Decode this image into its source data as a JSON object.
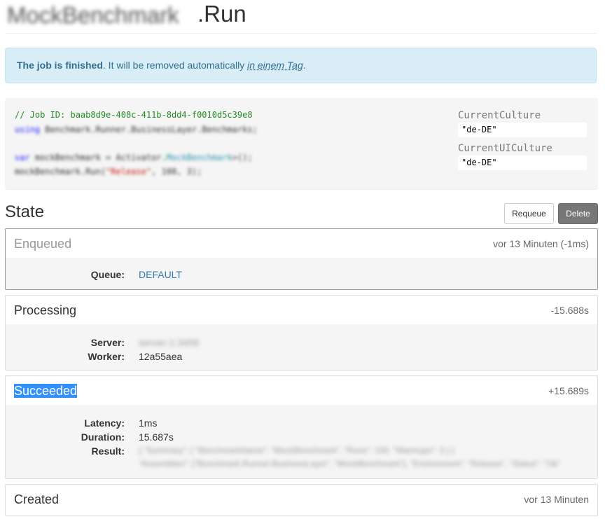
{
  "header": {
    "blurred_prefix": "MockBenchmark",
    "title": ".Run"
  },
  "alert": {
    "bold": "The job is finished",
    "text": ". It will be removed automatically ",
    "relative_time": "in einem Tag",
    "end": "."
  },
  "code": {
    "comment": "// Job ID: baab8d9e-408c-411b-8dd4-f0010d5c39e8",
    "line2_kw": "using",
    "line2_rest": " Benchmark.Runner.BusinessLayer.Benchmarks;",
    "line3_kw": "var",
    "line3_a": " mockBenchmark = Activator.",
    "line3_type": "MockBenchmark",
    "line3_b": ">();",
    "line4_a": "mockBenchmark.Run(",
    "line4_str": "\"Release\"",
    "line4_b": ", 100, 3);"
  },
  "culture": {
    "current_label": "CurrentCulture",
    "current_value": "\"de-DE\"",
    "ui_label": "CurrentUICulture",
    "ui_value": "\"de-DE\""
  },
  "state": {
    "heading": "State",
    "requeue_label": "Requeue",
    "delete_label": "Delete"
  },
  "states": {
    "enqueued": {
      "name": "Enqueued",
      "time": "vor 13 Minuten (-1ms)",
      "queue_key": "Queue:",
      "queue_value": "DEFAULT"
    },
    "processing": {
      "name": "Processing",
      "time": "-15.688s",
      "server_key": "Server:",
      "server_value": "server-1:3456",
      "worker_key": "Worker:",
      "worker_value": "12a55aea"
    },
    "succeeded": {
      "name": "Succeeded",
      "time": "+15.689s",
      "latency_key": "Latency:",
      "latency_value": "1ms",
      "duration_key": "Duration:",
      "duration_value": "15.687s",
      "result_key": "Result:",
      "result_line1": "{ \"Summary\": { \"BenchmarkName\": \"MockBenchmark\", \"Runs\": 100, \"Warmups\": 3 } }",
      "result_line2": "\"Assemblies\": [\"Benchmark.Runner.BusinessLayer\", \"MockBenchmark\"], \"Environment\": \"Release\", \"Status\": \"Ok\""
    },
    "created": {
      "name": "Created",
      "time": "vor 13 Minuten"
    }
  }
}
